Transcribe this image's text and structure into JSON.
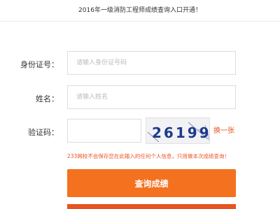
{
  "header": {
    "announcement": "2016年一级消防工程师成绩查询入口开通！"
  },
  "form": {
    "id_label": "身份证号：",
    "id_placeholder": "请输入身份证号码",
    "name_label": "姓名：",
    "name_placeholder": "请输入姓名",
    "captcha_label": "验证码：",
    "captcha_value": "",
    "captcha_text": "26199",
    "refresh_label": "换一张",
    "notice": "233网校不会保存您在此输入的任何个人信息，只用做本次成绩查询！",
    "submit_label": "查询成绩"
  },
  "colors": {
    "accent": "#f47120",
    "notice": "#e8541f"
  }
}
